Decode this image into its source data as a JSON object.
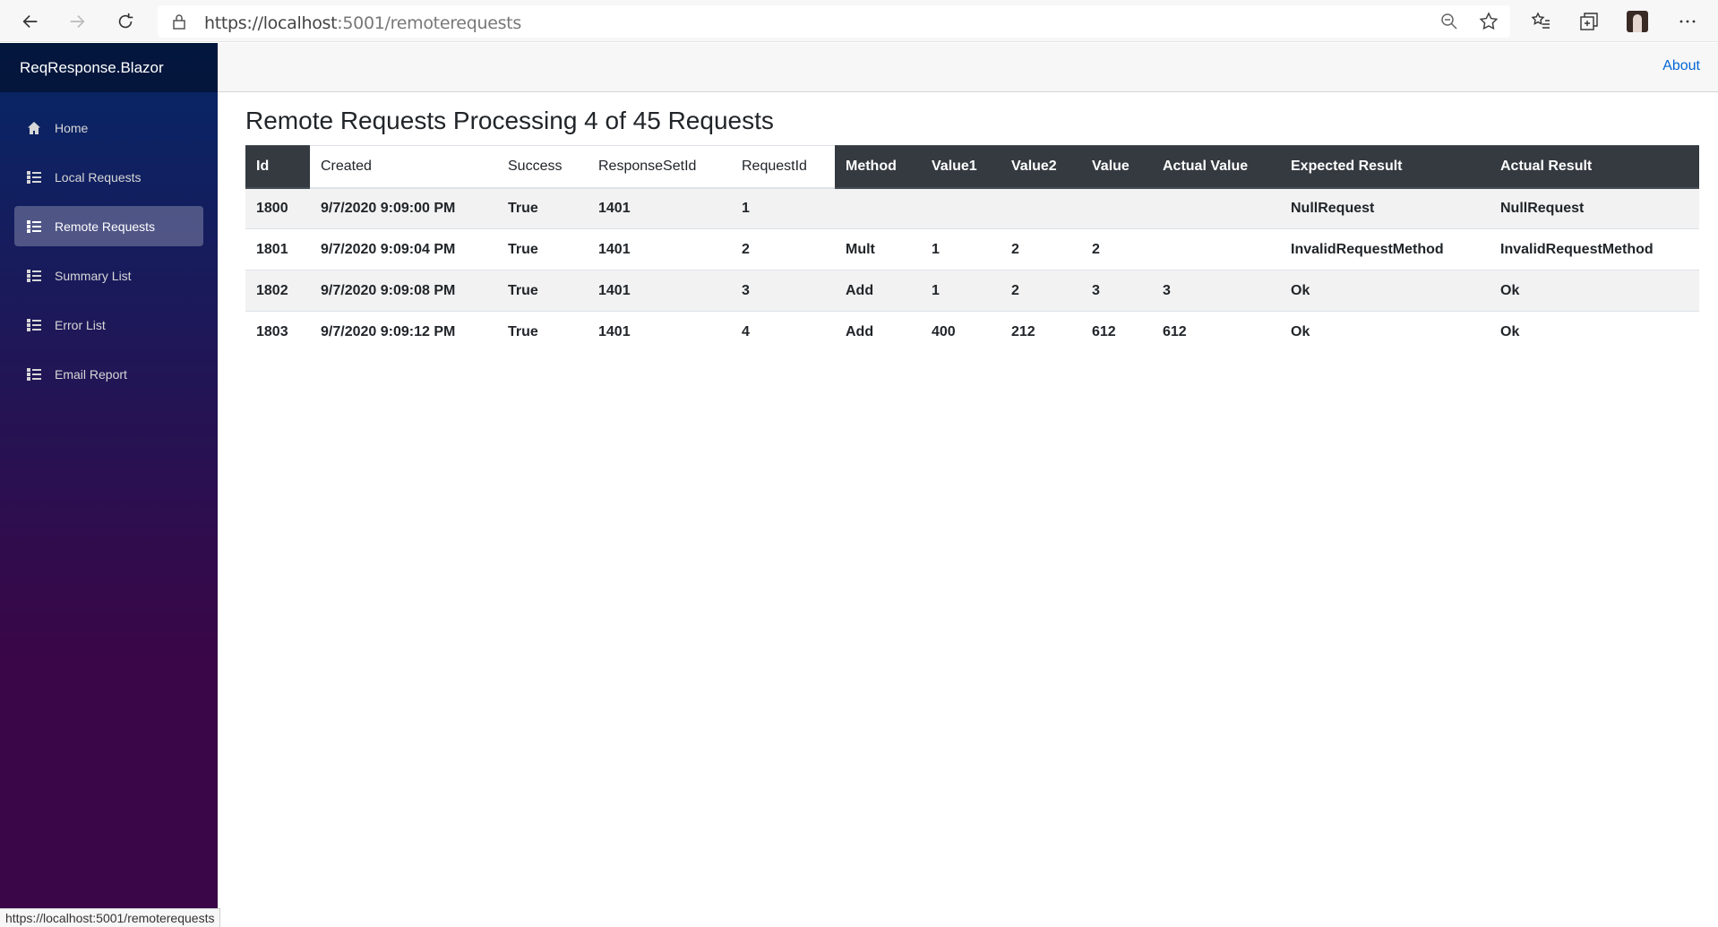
{
  "browser": {
    "url_host": "https://localhost",
    "url_rest": ":5001/remoterequests",
    "status_url": "https://localhost:5001/remoterequests"
  },
  "sidebar": {
    "brand": "ReqResponse.Blazor",
    "items": [
      {
        "label": "Home",
        "icon": "home-icon",
        "active": false
      },
      {
        "label": "Local Requests",
        "icon": "list-icon",
        "active": false
      },
      {
        "label": "Remote Requests",
        "icon": "list-icon",
        "active": true
      },
      {
        "label": "Summary List",
        "icon": "list-icon",
        "active": false
      },
      {
        "label": "Error List",
        "icon": "list-icon",
        "active": false
      },
      {
        "label": "Email Report",
        "icon": "list-icon",
        "active": false
      }
    ]
  },
  "header": {
    "about_label": "About"
  },
  "main": {
    "title": "Remote Requests Processing 4 of 45 Requests",
    "table": {
      "headers": [
        "Id",
        "Created",
        "Success",
        "ResponseSetId",
        "RequestId",
        "Method",
        "Value1",
        "Value2",
        "Value",
        "Actual Value",
        "Expected Result",
        "Actual Result"
      ],
      "rows": [
        [
          "1800",
          "9/7/2020 9:09:00 PM",
          "True",
          "1401",
          "1",
          "",
          "",
          "",
          "",
          "",
          "NullRequest",
          "NullRequest"
        ],
        [
          "1801",
          "9/7/2020 9:09:04 PM",
          "True",
          "1401",
          "2",
          "Mult",
          "1",
          "2",
          "2",
          "",
          "InvalidRequestMethod",
          "InvalidRequestMethod"
        ],
        [
          "1802",
          "9/7/2020 9:09:08 PM",
          "True",
          "1401",
          "3",
          "Add",
          "1",
          "2",
          "3",
          "3",
          "Ok",
          "Ok"
        ],
        [
          "1803",
          "9/7/2020 9:09:12 PM",
          "True",
          "1401",
          "4",
          "Add",
          "400",
          "212",
          "612",
          "612",
          "Ok",
          "Ok"
        ]
      ]
    }
  },
  "colors": {
    "sidebar_top": "#052767",
    "sidebar_bottom": "#3a0647",
    "header_dark": "#343a40",
    "link": "#0366d6"
  }
}
